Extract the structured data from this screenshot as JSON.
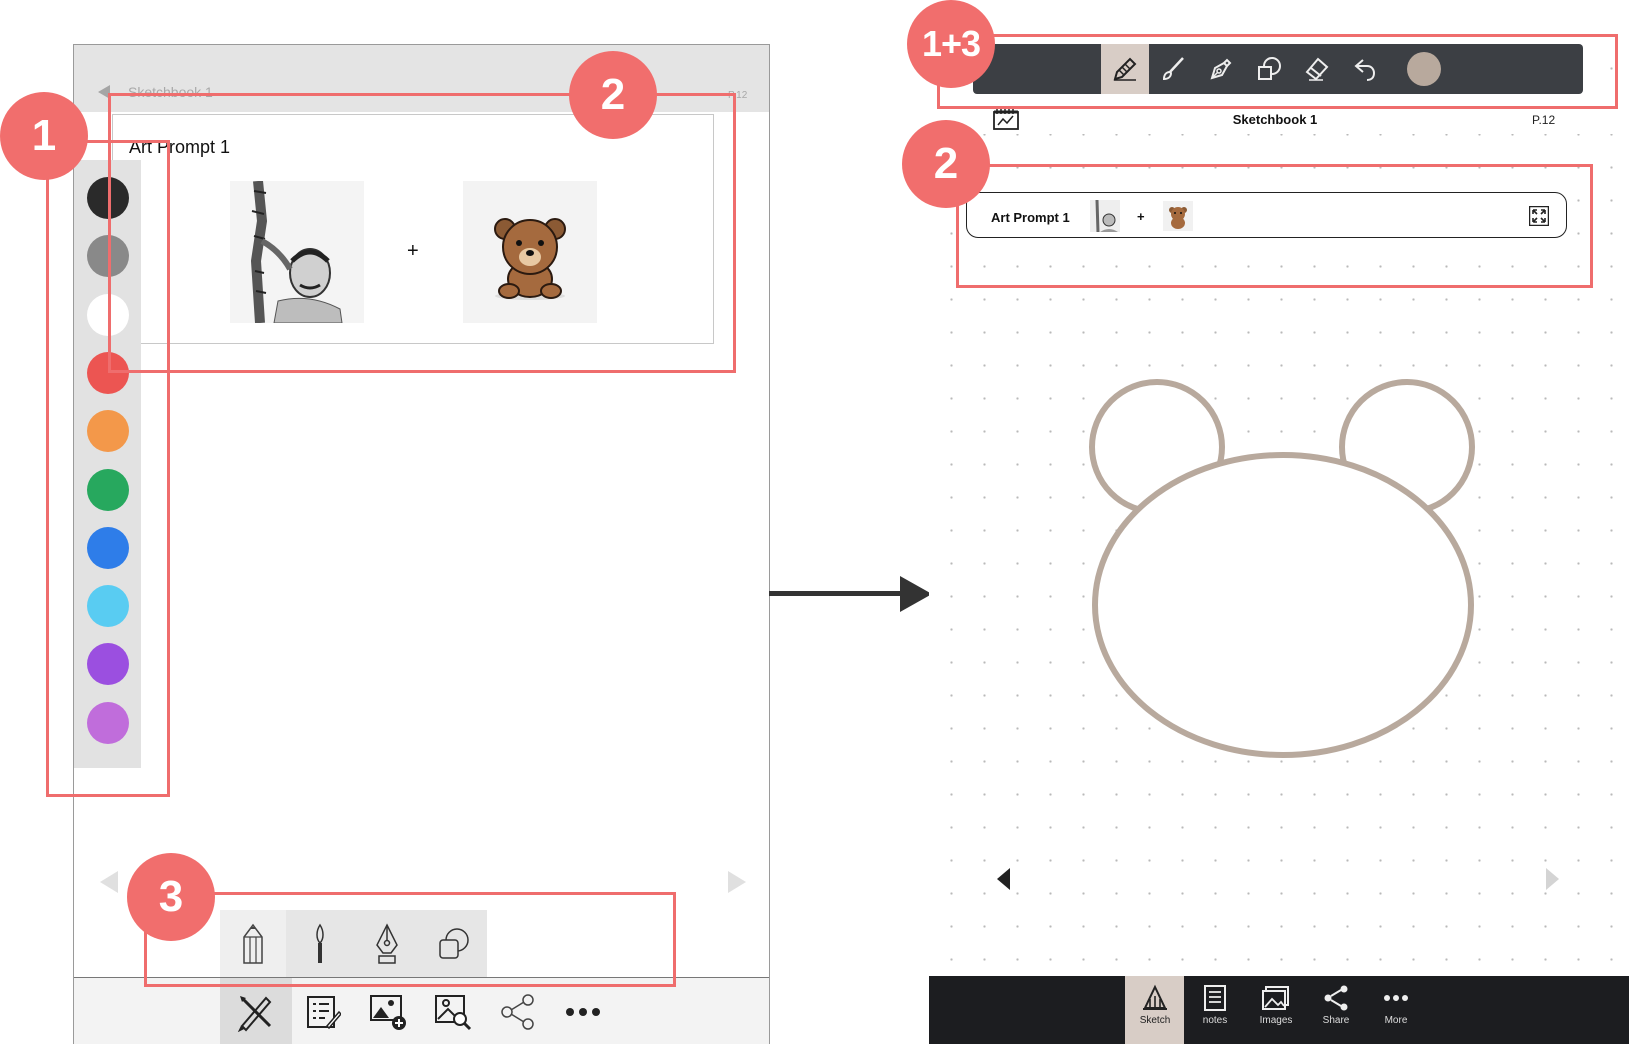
{
  "left": {
    "title": "Sketchbook 1",
    "page": "P.12",
    "prompt_title": "Art Prompt 1",
    "plus": "+",
    "palette": [
      "#2a2a2a",
      "#898989",
      "#ffffff",
      "#ec5552",
      "#f3984a",
      "#27a85e",
      "#2e7de9",
      "#59ccf2",
      "#9b4fe0",
      "#c06ddb"
    ],
    "tools": [
      "pencil-icon",
      "brush-icon",
      "pen-nib-icon",
      "shapes-icon"
    ],
    "nav": [
      "sketch-icon",
      "notes-icon",
      "add-image-icon",
      "image-search-icon",
      "share-icon",
      "more-icon"
    ]
  },
  "right": {
    "title": "Sketchbook 1",
    "page": "P.12",
    "prompt_title": "Art Prompt 1",
    "plus": "+",
    "toolbar": [
      "pencil-icon",
      "brush-icon",
      "pen-nib-icon",
      "shapes-icon",
      "eraser-icon",
      "undo-icon"
    ],
    "current_color": "#b8a99d",
    "nav": [
      {
        "icon": "sketch-icon",
        "label": "Sketch"
      },
      {
        "icon": "notes-icon",
        "label": "notes"
      },
      {
        "icon": "images-icon",
        "label": "Images"
      },
      {
        "icon": "share-icon",
        "label": "Share"
      },
      {
        "icon": "more-icon",
        "label": "More"
      }
    ]
  },
  "annotations": {
    "badge_1": "1",
    "badge_2_left": "2",
    "badge_3": "3",
    "badge_1_3": "1+3",
    "badge_2_right": "2"
  },
  "colors": {
    "annotation": "#ef6d6d",
    "toolbar_dark": "#3c3f44",
    "accent_beige": "#d8cdc6",
    "sketch_stroke": "#b8a99d"
  }
}
